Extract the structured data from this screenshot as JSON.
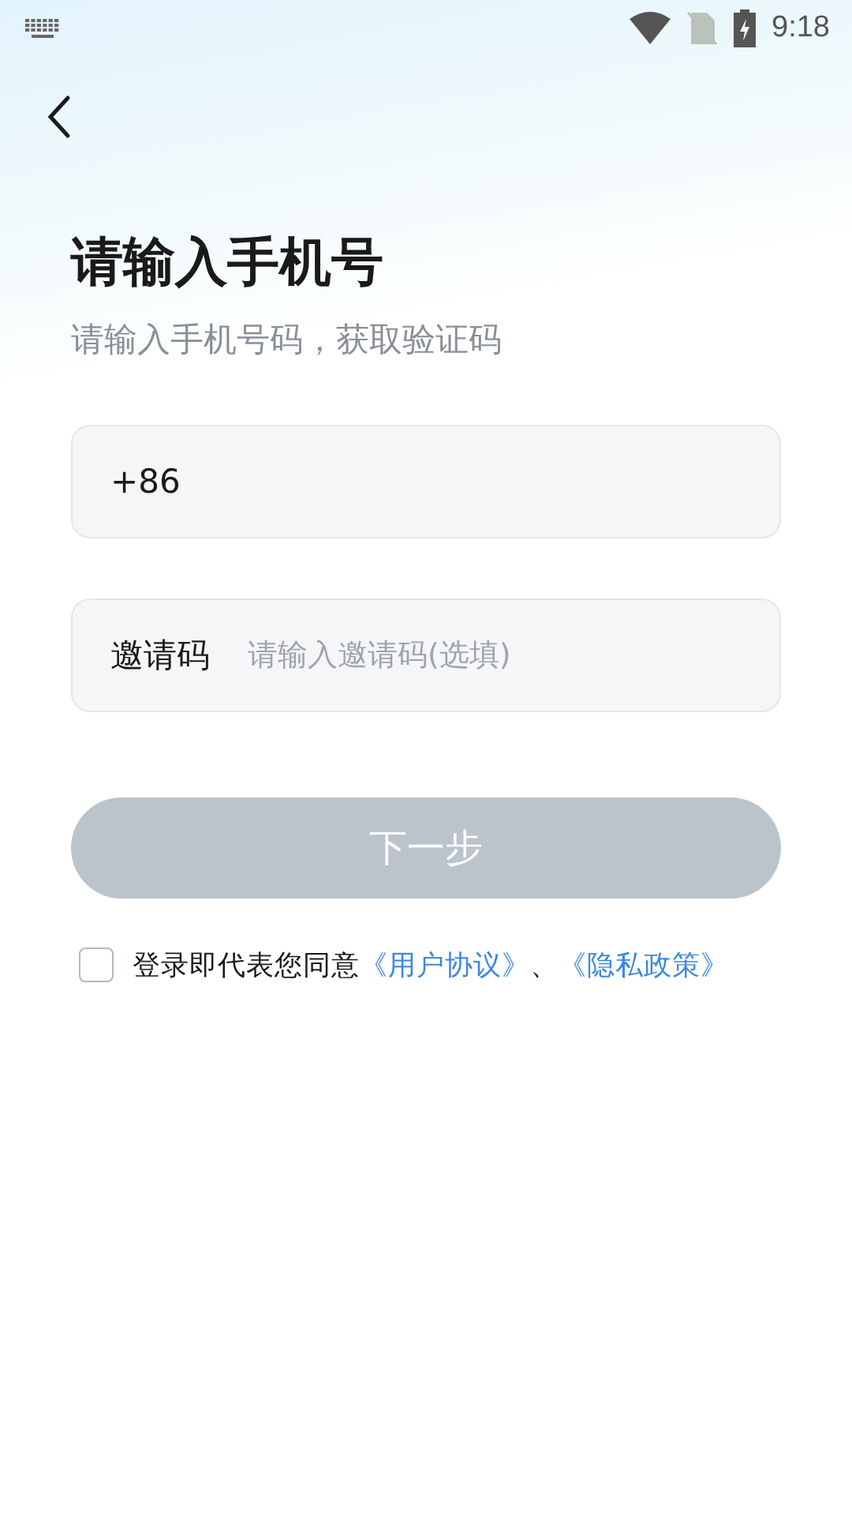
{
  "status_bar": {
    "time": "9:18"
  },
  "title": "请输入手机号",
  "subtitle": "请输入手机号码，获取验证码",
  "phone_field": {
    "prefix": "+86"
  },
  "invite_field": {
    "label": "邀请码",
    "placeholder": "请输入邀请码(选填)"
  },
  "next_button": {
    "label": "下一步",
    "disabled": true
  },
  "agreement": {
    "checked": false,
    "text": "登录即代表您同意",
    "links": [
      "《用户协议》",
      "《隐私政策》"
    ],
    "separator": "、"
  }
}
